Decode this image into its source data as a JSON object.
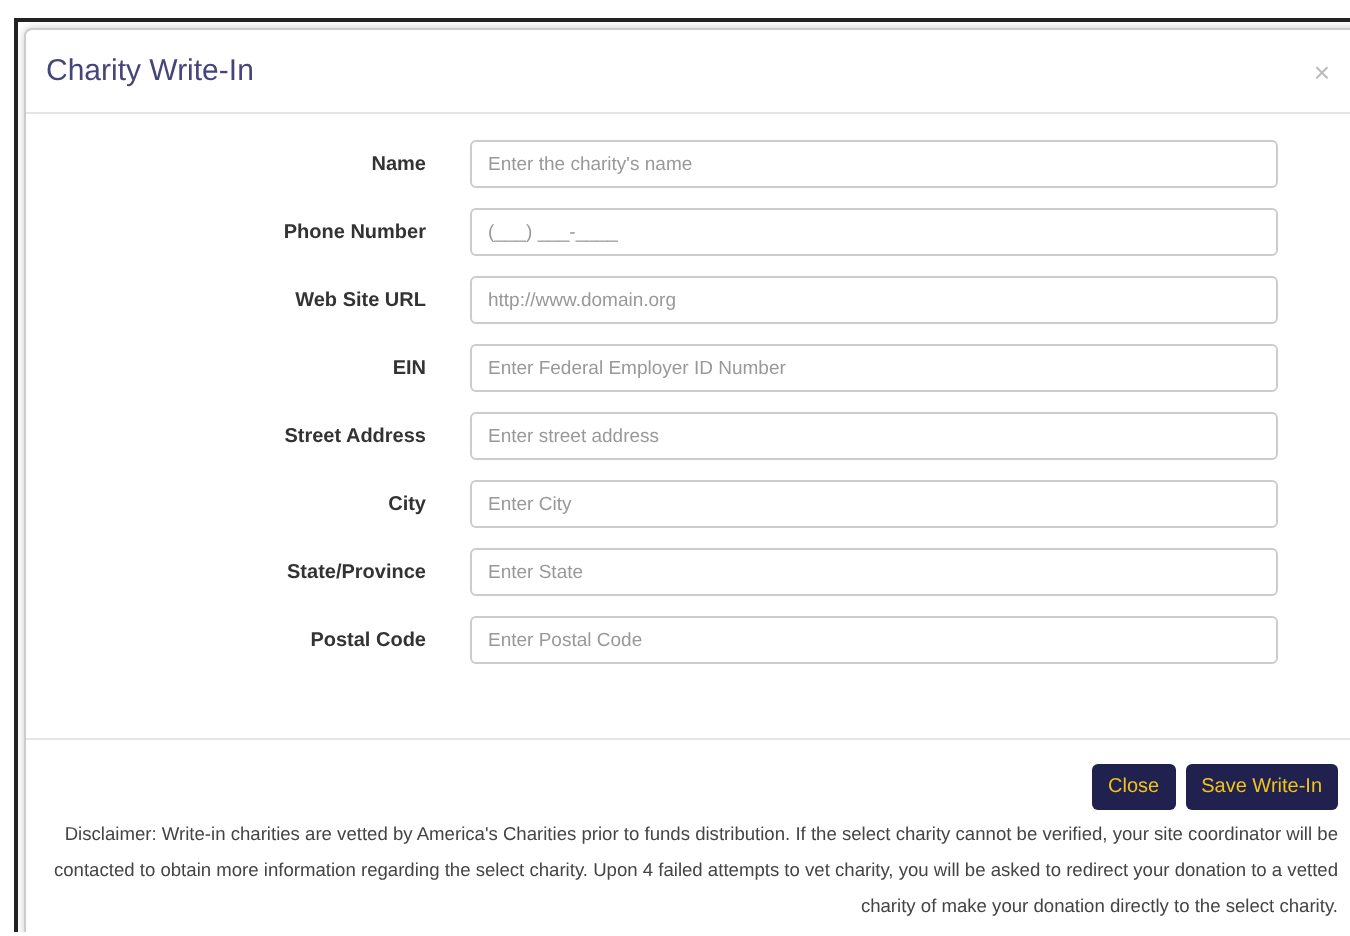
{
  "dialog": {
    "title": "Charity Write-In",
    "close_icon": "×"
  },
  "fields": [
    {
      "label": "Name",
      "placeholder": "Enter the charity's name"
    },
    {
      "label": "Phone Number",
      "placeholder": "(___) ___-____"
    },
    {
      "label": "Web Site URL",
      "placeholder": "http://www.domain.org"
    },
    {
      "label": "EIN",
      "placeholder": "Enter Federal Employer ID Number"
    },
    {
      "label": "Street Address",
      "placeholder": "Enter street address"
    },
    {
      "label": "City",
      "placeholder": "Enter City"
    },
    {
      "label": "State/Province",
      "placeholder": "Enter State"
    },
    {
      "label": "Postal Code",
      "placeholder": "Enter Postal Code"
    }
  ],
  "buttons": [
    "Close",
    "Save Write-In"
  ],
  "disclaimer": "Disclaimer: Write-in charities are vetted by America's Charities prior to funds distribution. If the select charity cannot be verified, your site coordinator will be contacted to obtain more information regarding the select charity. Upon 4 failed attempts to vet charity, you will be asked to redirect your donation to a vetted charity of make your donation directly to the select charity."
}
